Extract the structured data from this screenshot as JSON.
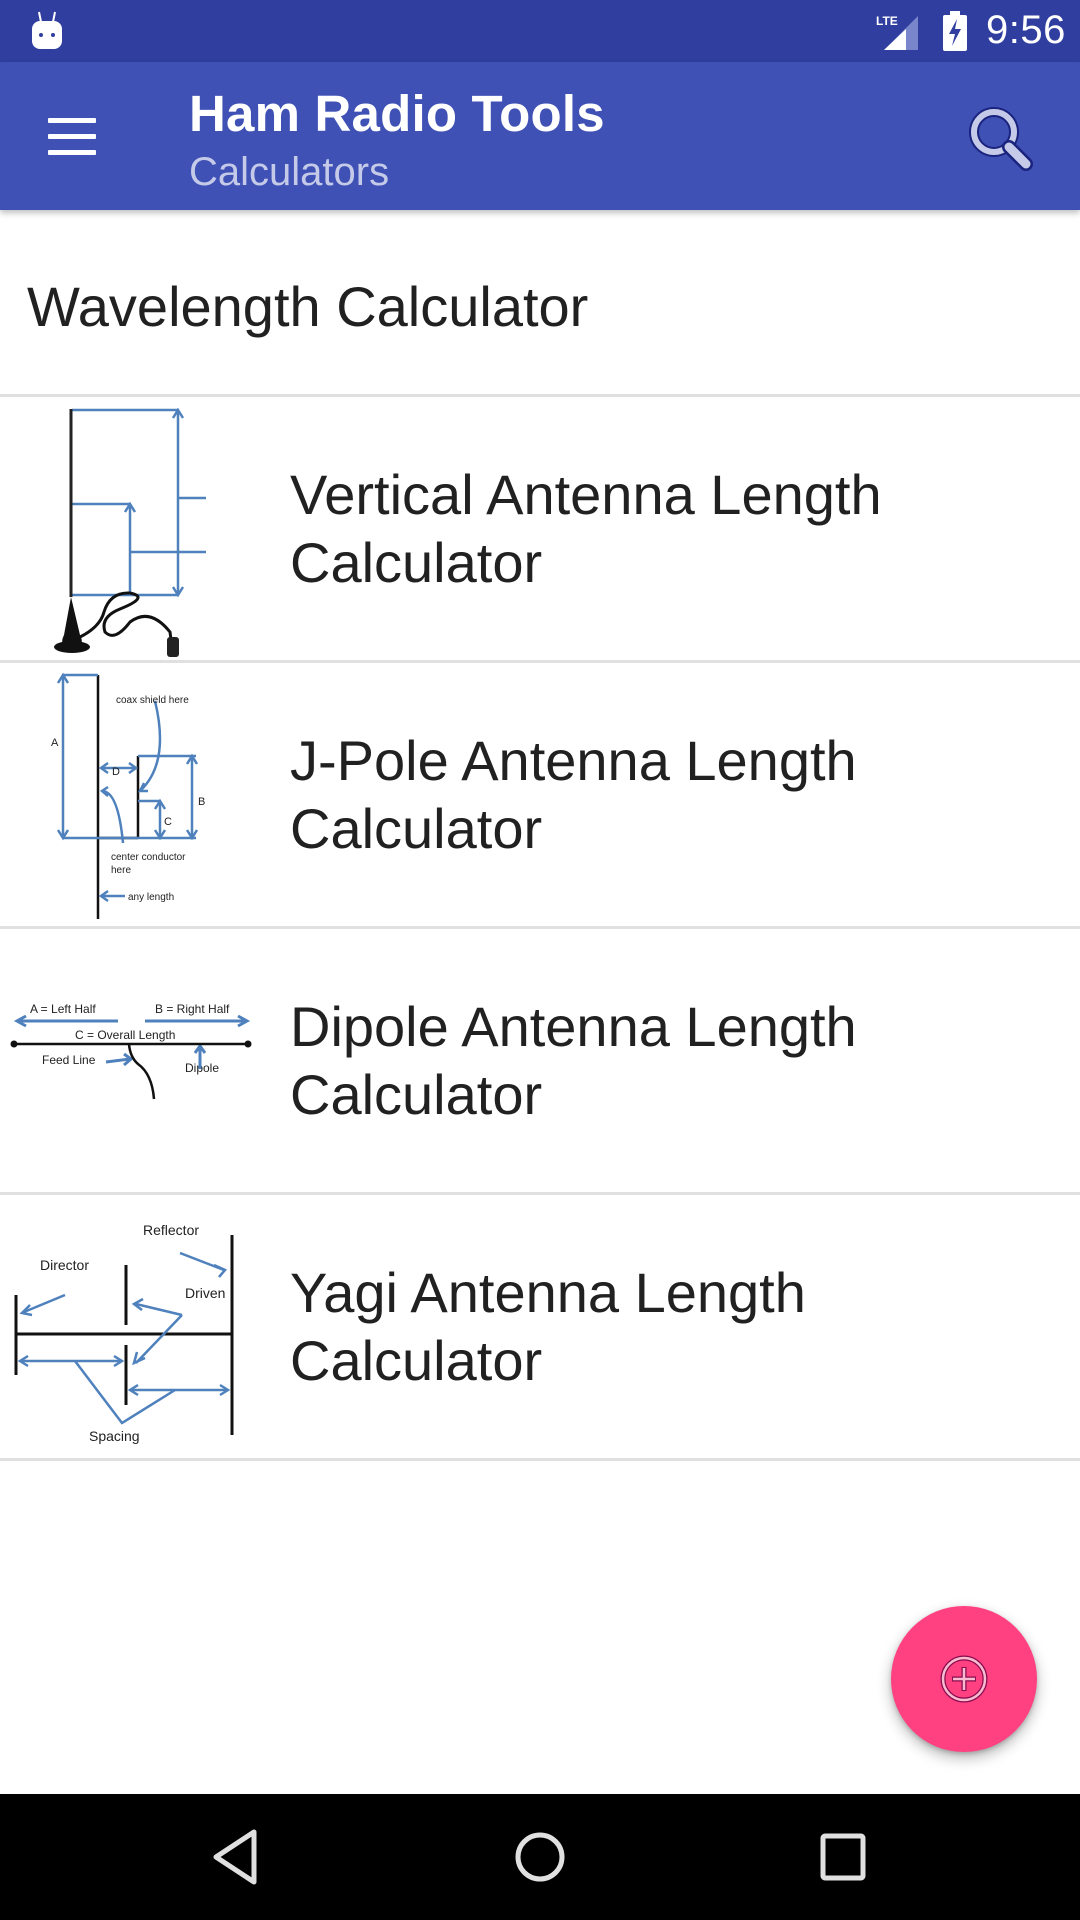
{
  "status_bar": {
    "time": "9:56",
    "network": "LTE",
    "icons": [
      "android-notification-icon",
      "lte-signal-icon",
      "battery-charging-icon"
    ]
  },
  "app_bar": {
    "title": "Ham Radio Tools",
    "subtitle": "Calculators",
    "menu_icon": "hamburger-menu-icon",
    "search_icon": "search-icon"
  },
  "list": {
    "header_item": {
      "label": "Wavelength Calculator"
    },
    "items": [
      {
        "label": "Vertical Antenna Length Calculator",
        "thumbnail": "vertical-antenna-diagram"
      },
      {
        "label": "J-Pole Antenna Length Calculator",
        "thumbnail": "j-pole-antenna-diagram",
        "diagram_labels": [
          "A",
          "B",
          "C",
          "D",
          "coax shield here",
          "center conductor here",
          "any length"
        ]
      },
      {
        "label": "Dipole Antenna Length Calculator",
        "thumbnail": "dipole-antenna-diagram",
        "diagram_labels": [
          "A = Left Half",
          "B = Right Half",
          "C = Overall Length",
          "Feed Line",
          "Dipole"
        ]
      },
      {
        "label": "Yagi Antenna Length Calculator",
        "thumbnail": "yagi-antenna-diagram",
        "diagram_labels": [
          "Reflector",
          "Director",
          "Driven",
          "Spacing"
        ]
      }
    ]
  },
  "fab": {
    "icon": "add-circle-icon"
  },
  "nav_bar": {
    "buttons": [
      "back",
      "home",
      "recents"
    ]
  },
  "colors": {
    "status_bar": "#303f9f",
    "primary": "#3f51b5",
    "subtitle": "#c5cae9",
    "accent": "#ff4081",
    "diagram_blue": "#4f81bd",
    "divider": "#e0e0e0"
  }
}
